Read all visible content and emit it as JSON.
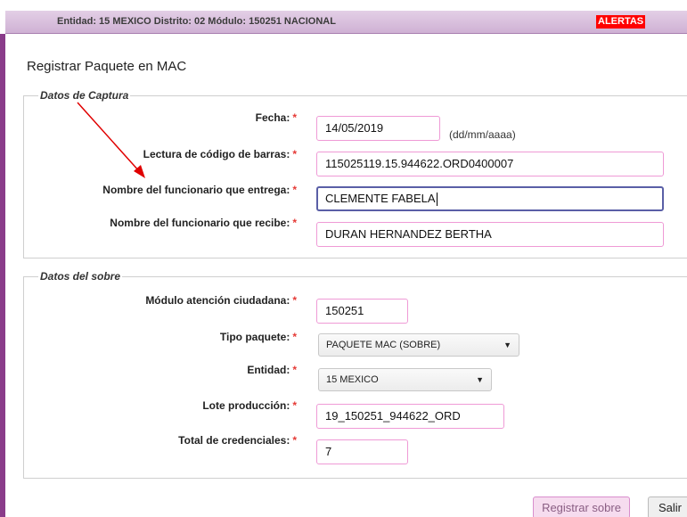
{
  "header": {
    "info": "Entidad: 15 MEXICO Distrito: 02 Módulo: 150251 NACIONAL",
    "alertas": "ALERTAS"
  },
  "page_title": "Registrar Paquete en MAC",
  "captura": {
    "legend": "Datos de Captura",
    "fecha": {
      "label": "Fecha:",
      "value": "14/05/2019",
      "hint": "(dd/mm/aaaa)"
    },
    "codigo": {
      "label": "Lectura de código de barras:",
      "value": "115025119.15.944622.ORD0400007"
    },
    "entrega": {
      "label": "Nombre del funcionario que entrega:",
      "value": "CLEMENTE FABELA"
    },
    "recibe": {
      "label": "Nombre del funcionario que recibe:",
      "value": "DURAN HERNANDEZ BERTHA"
    }
  },
  "sobre": {
    "legend": "Datos del sobre",
    "modulo": {
      "label": "Módulo atención ciudadana:",
      "value": "150251"
    },
    "tipo": {
      "label": "Tipo paquete:",
      "selected": "PAQUETE MAC (SOBRE)"
    },
    "entidad": {
      "label": "Entidad:",
      "selected": "15 MEXICO"
    },
    "lote": {
      "label": "Lote producción:",
      "value": "19_150251_944622_ORD"
    },
    "total": {
      "label": "Total de credenciales:",
      "value": "7"
    }
  },
  "required_mark": "*",
  "buttons": {
    "registrar": "Registrar sobre",
    "salir": "Salir"
  },
  "colors": {
    "header_bg": "#d6bcdb",
    "sidebar": "#8a3c8a",
    "alert": "#ff0000",
    "field_border": "#ef9ad6",
    "annotation_arrow": "#e00000"
  },
  "icons": {
    "select_arrow": "▼"
  }
}
